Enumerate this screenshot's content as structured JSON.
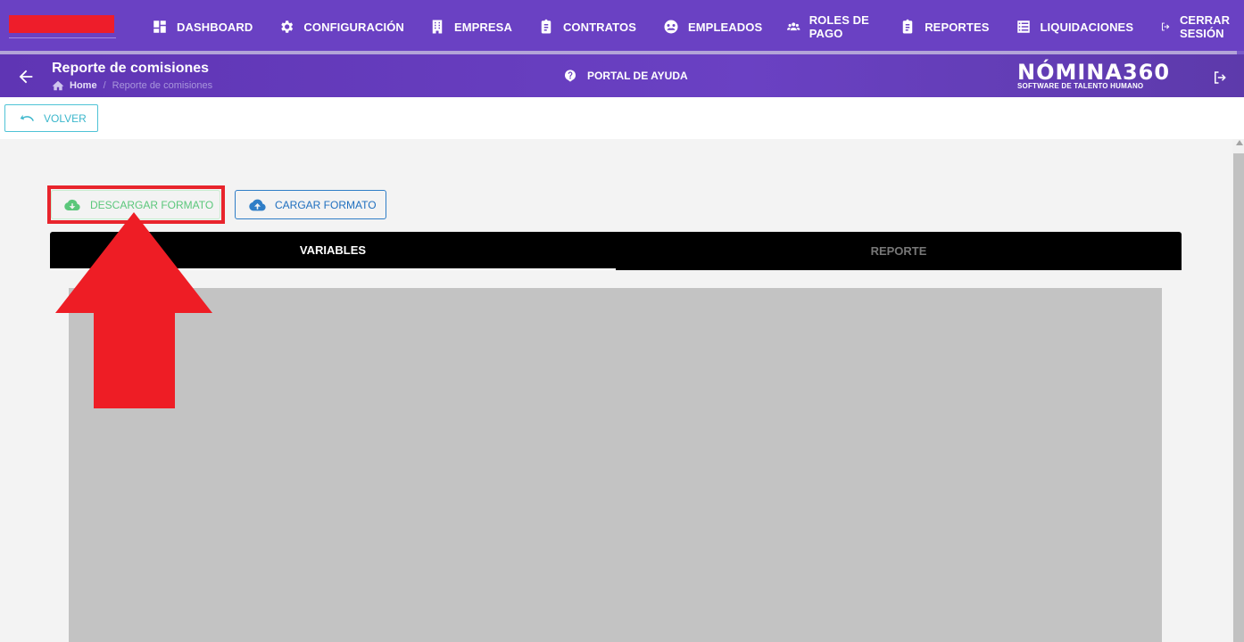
{
  "nav": {
    "items": [
      {
        "label": "DASHBOARD",
        "icon": "dashboard-icon"
      },
      {
        "label": "CONFIGURACIÓN",
        "icon": "gear-icon"
      },
      {
        "label": "EMPRESA",
        "icon": "building-icon"
      },
      {
        "label": "CONTRATOS",
        "icon": "clipboard-icon"
      },
      {
        "label": "EMPLEADOS",
        "icon": "people-icon"
      },
      {
        "label": "ROLES DE PAGO",
        "icon": "group-icon"
      },
      {
        "label": "REPORTES",
        "icon": "clipboard-icon"
      },
      {
        "label": "LIQUIDACIONES",
        "icon": "list-icon"
      },
      {
        "label": "CERRAR SESIÓN",
        "icon": "logout-icon"
      }
    ]
  },
  "header": {
    "title": "Reporte de comisiones",
    "breadcrumb_home": "Home",
    "breadcrumb_separator": "/",
    "breadcrumb_current": "Reporte de comisiones",
    "help_label": "PORTAL DE AYUDA",
    "brand_name": "NÓMINA360",
    "brand_tagline": "SOFTWARE DE TALENTO HUMANO"
  },
  "toolbar": {
    "back_label": "VOLVER"
  },
  "actions": {
    "download_label": "DESCARGAR FORMATO",
    "upload_label": "CARGAR FORMATO"
  },
  "tabs": [
    {
      "label": "VARIABLES",
      "active": true
    },
    {
      "label": "REPORTE",
      "active": false
    }
  ],
  "colors": {
    "nav_bg": "#6a41c3",
    "highlight": "#e8242c",
    "download_green": "#5bc77b",
    "upload_blue": "#1f6fbf",
    "volver_cyan": "#3bb7cc"
  }
}
